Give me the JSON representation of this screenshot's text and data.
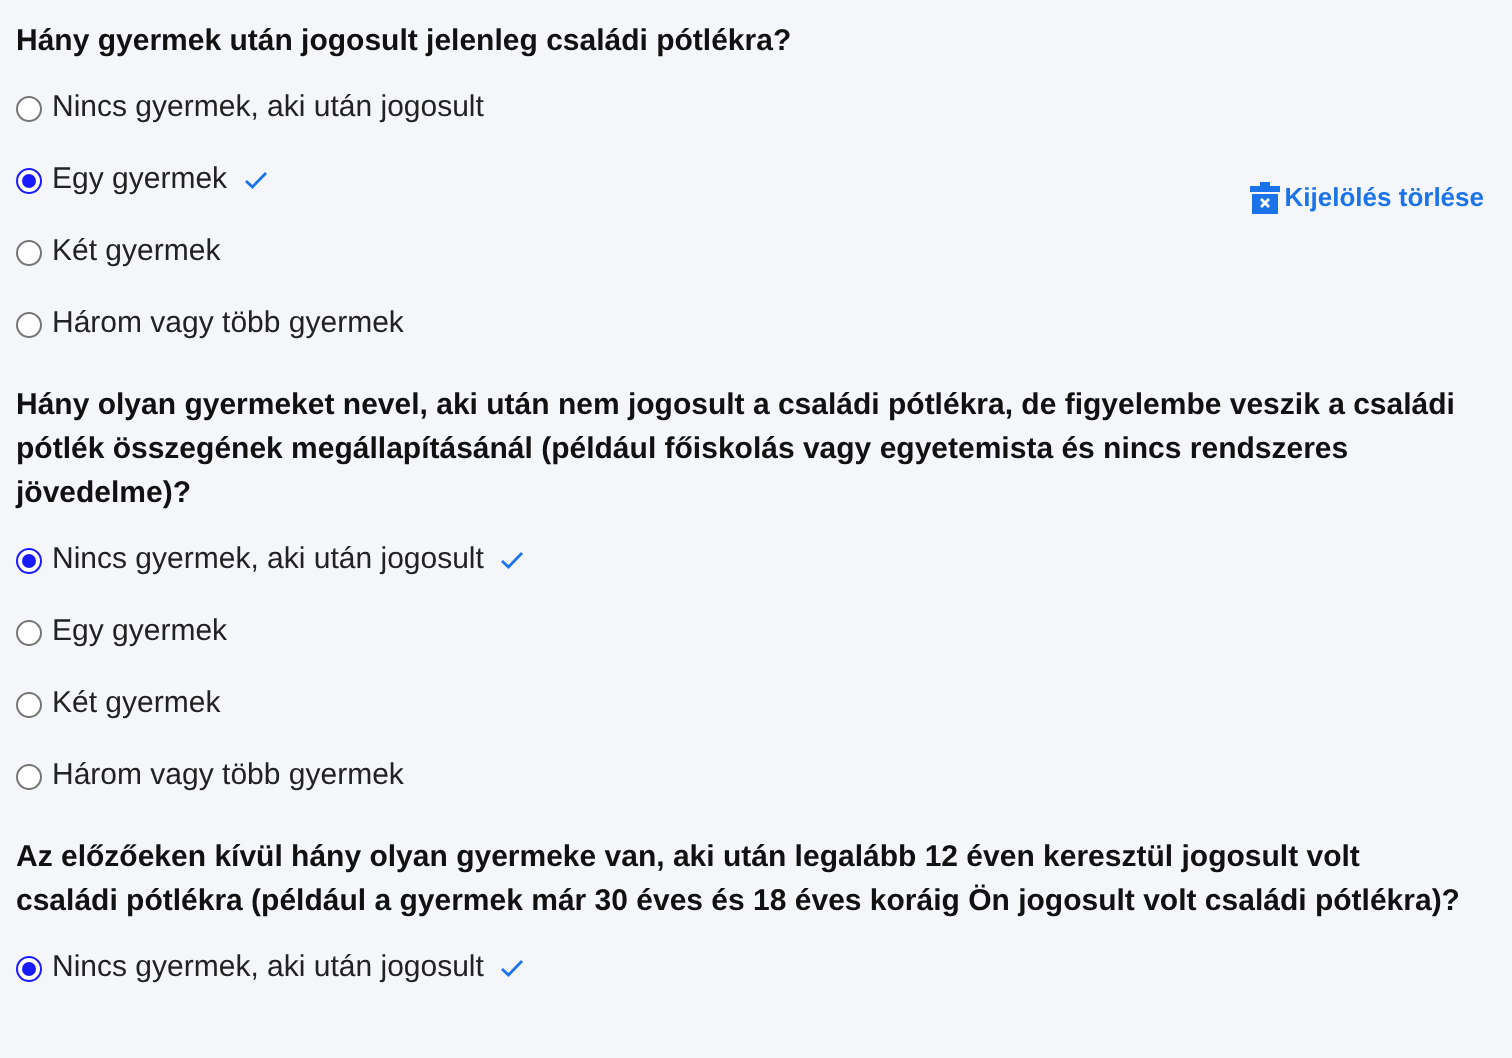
{
  "questions": [
    {
      "text": "Hány gyermek után jogosult jelenleg családi pótlékra?",
      "clear_button": "Kijelölés törlése",
      "options": [
        {
          "label": "Nincs gyermek, aki után jogosult",
          "selected": false
        },
        {
          "label": "Egy gyermek",
          "selected": true
        },
        {
          "label": "Két gyermek",
          "selected": false
        },
        {
          "label": "Három vagy több gyermek",
          "selected": false
        }
      ]
    },
    {
      "text": "Hány olyan gyermeket nevel, aki után nem jogosult a családi pótlékra, de figyelembe veszik a családi pótlék összegének megállapításánál (például főiskolás vagy egyetemista és nincs rendszeres jövedelme)?",
      "options": [
        {
          "label": "Nincs gyermek, aki után jogosult",
          "selected": true
        },
        {
          "label": "Egy gyermek",
          "selected": false
        },
        {
          "label": "Két gyermek",
          "selected": false
        },
        {
          "label": "Három vagy több gyermek",
          "selected": false
        }
      ]
    },
    {
      "text": "Az előzőeken kívül hány olyan gyermeke van, aki után legalább 12 éven keresztül jogosult volt családi pótlékra (például a gyermek már 30 éves és 18 éves koráig Ön jogosult volt családi pótlékra)?",
      "options": [
        {
          "label": "Nincs gyermek, aki után jogosult",
          "selected": true
        }
      ]
    }
  ]
}
